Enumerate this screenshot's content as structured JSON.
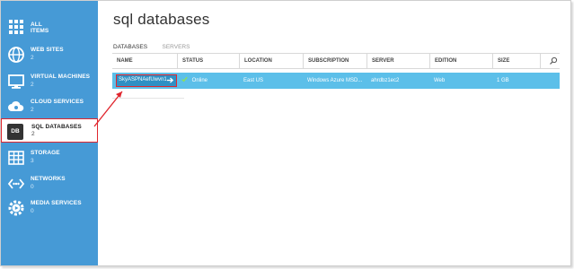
{
  "sidebar": {
    "items": [
      {
        "label": "ALL ITEMS",
        "count": ""
      },
      {
        "label": "WEB SITES",
        "count": "2"
      },
      {
        "label": "VIRTUAL MACHINES",
        "count": "2"
      },
      {
        "label": "CLOUD SERVICES",
        "count": "2"
      },
      {
        "label": "SQL DATABASES",
        "count": "2",
        "icon_text": "DB"
      },
      {
        "label": "STORAGE",
        "count": "3"
      },
      {
        "label": "NETWORKS",
        "count": "0"
      },
      {
        "label": "MEDIA SERVICES",
        "count": "0"
      }
    ]
  },
  "main": {
    "title": "sql databases",
    "tabs": [
      "DATABASES",
      "SERVERS"
    ],
    "table": {
      "columns": [
        "NAME",
        "STATUS",
        "LOCATION",
        "SUBSCRIPTION",
        "SERVER",
        "EDITION",
        "SIZE"
      ],
      "rows": [
        {
          "name": "SkyASPNAefUwvn1",
          "status": "Online",
          "location": "East US",
          "subscription": "Windows Azure MSD...",
          "server": "ahrdbz1ec2",
          "edition": "Web",
          "size": "1 GB"
        }
      ]
    }
  },
  "colors": {
    "sidebar": "#469ad6",
    "selected_row": "#5cbfe9",
    "annotation": "#e0262e",
    "status_ok": "#8de05a"
  }
}
